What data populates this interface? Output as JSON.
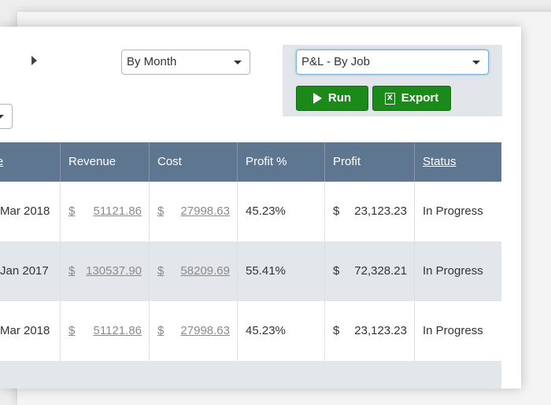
{
  "controls": {
    "period_select": "By Month",
    "report_select": "P&L - By Job",
    "run_label": "Run",
    "export_label": "Export"
  },
  "table": {
    "headers": [
      "d Date",
      "Revenue",
      "Cost",
      "Profit %",
      "Profit",
      "Status"
    ],
    "rows": [
      {
        "date": "Mar 2018",
        "revenue_cur": "$",
        "revenue": "51121.86",
        "cost_cur": "$",
        "cost": "27998.63",
        "profit_pct": "45.23%",
        "profit_cur": "$",
        "profit": "23,123.23",
        "status": "In Progress"
      },
      {
        "date": "Jan 2017",
        "revenue_cur": "$",
        "revenue": "130537.90",
        "cost_cur": "$",
        "cost": "58209.69",
        "profit_pct": "55.41%",
        "profit_cur": "$",
        "profit": "72,328.21",
        "status": "In Progress"
      },
      {
        "date": "Mar 2018",
        "revenue_cur": "$",
        "revenue": "51121.86",
        "cost_cur": "$",
        "cost": "27998.63",
        "profit_pct": "45.23%",
        "profit_cur": "$",
        "profit": "23,123.23",
        "status": "In Progress"
      }
    ]
  },
  "colors": {
    "header_bg": "#5f7691",
    "button_green": "#1b8a1b",
    "panel_bg": "#e2e6ea"
  }
}
